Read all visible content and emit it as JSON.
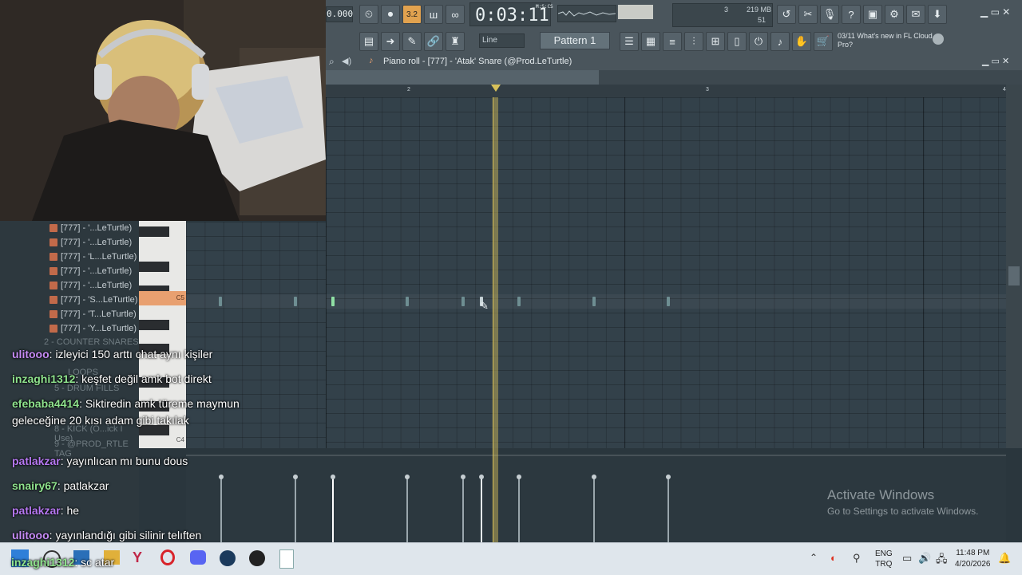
{
  "toolbar": {
    "tempo": "0.000",
    "time": "0:03:11",
    "time_unit": "M:S:CS",
    "pattern_name": "Pattern 1",
    "snap": "Line",
    "cpu_value": "3",
    "memory": "219 MB",
    "polyphony": "51",
    "news_counter": "03/11",
    "news_text": "What's new in FL Cloud Pro?"
  },
  "piano_roll": {
    "title": "Piano roll - [777] - 'Atak' Snare (@Prod.LeTurtle)",
    "ruler_marks": [
      "2",
      "3",
      "4"
    ],
    "key_label_c5": "C5",
    "key_label_c4": "C4"
  },
  "playlist_panel": {
    "rows": [
      "[777] - '...LeTurtle)",
      "[777] - '...LeTurtle)",
      "[777] - 'L...LeTurtle)",
      "[777] - '...LeTurtle)",
      "[777] - '...LeTurtle)",
      "[777] - 'S...LeTurtle)",
      "[777] - 'T...LeTurtle)",
      "[777] - 'Y...LeTurtle)"
    ],
    "groups": [
      "2 - COUNTER SNARES",
      "LOOPS",
      "5 - DRUM FILLS",
      "8 - KICK (O...ick I Use)",
      "9 - @PROD_RTLE TAG"
    ]
  },
  "chat": [
    {
      "user": "ulitooo",
      "color": "#c78cf7",
      "text": "izleyici 150 arttı chat aynı kişiler"
    },
    {
      "user": "inzaghi1312",
      "color": "#8fe38d",
      "text": "keşfet değil amk bot direkt"
    },
    {
      "user": "efebaba4414",
      "color": "#8fe38d",
      "text": "Siktiredin amk türeme maymun geleceğine 20 kısı adam gibi takılak"
    },
    {
      "user": "patlakzar",
      "color": "#b678f2",
      "text": "yayınlıcan mı bunu dous"
    },
    {
      "user": "snairy67",
      "color": "#8fe38d",
      "text": "patlakzar"
    },
    {
      "user": "patlakzar",
      "color": "#b678f2",
      "text": "he"
    },
    {
      "user": "ulitooo",
      "color": "#c78cf7",
      "text": "yayınlandığı gibi silinir telıften"
    },
    {
      "user": "inzaghi1312",
      "color": "#8fe38d",
      "text": "sc atar"
    }
  ],
  "watermark": {
    "title": "Activate Windows",
    "subtitle": "Go to Settings to activate Windows."
  },
  "taskbar": {
    "lang_line1": "ENG",
    "lang_line2": "TRQ",
    "time": "11:48 PM",
    "date": "4/20/2026"
  },
  "colors": {
    "playhead": "#d8c15a",
    "accent_orange": "#e8a070"
  }
}
